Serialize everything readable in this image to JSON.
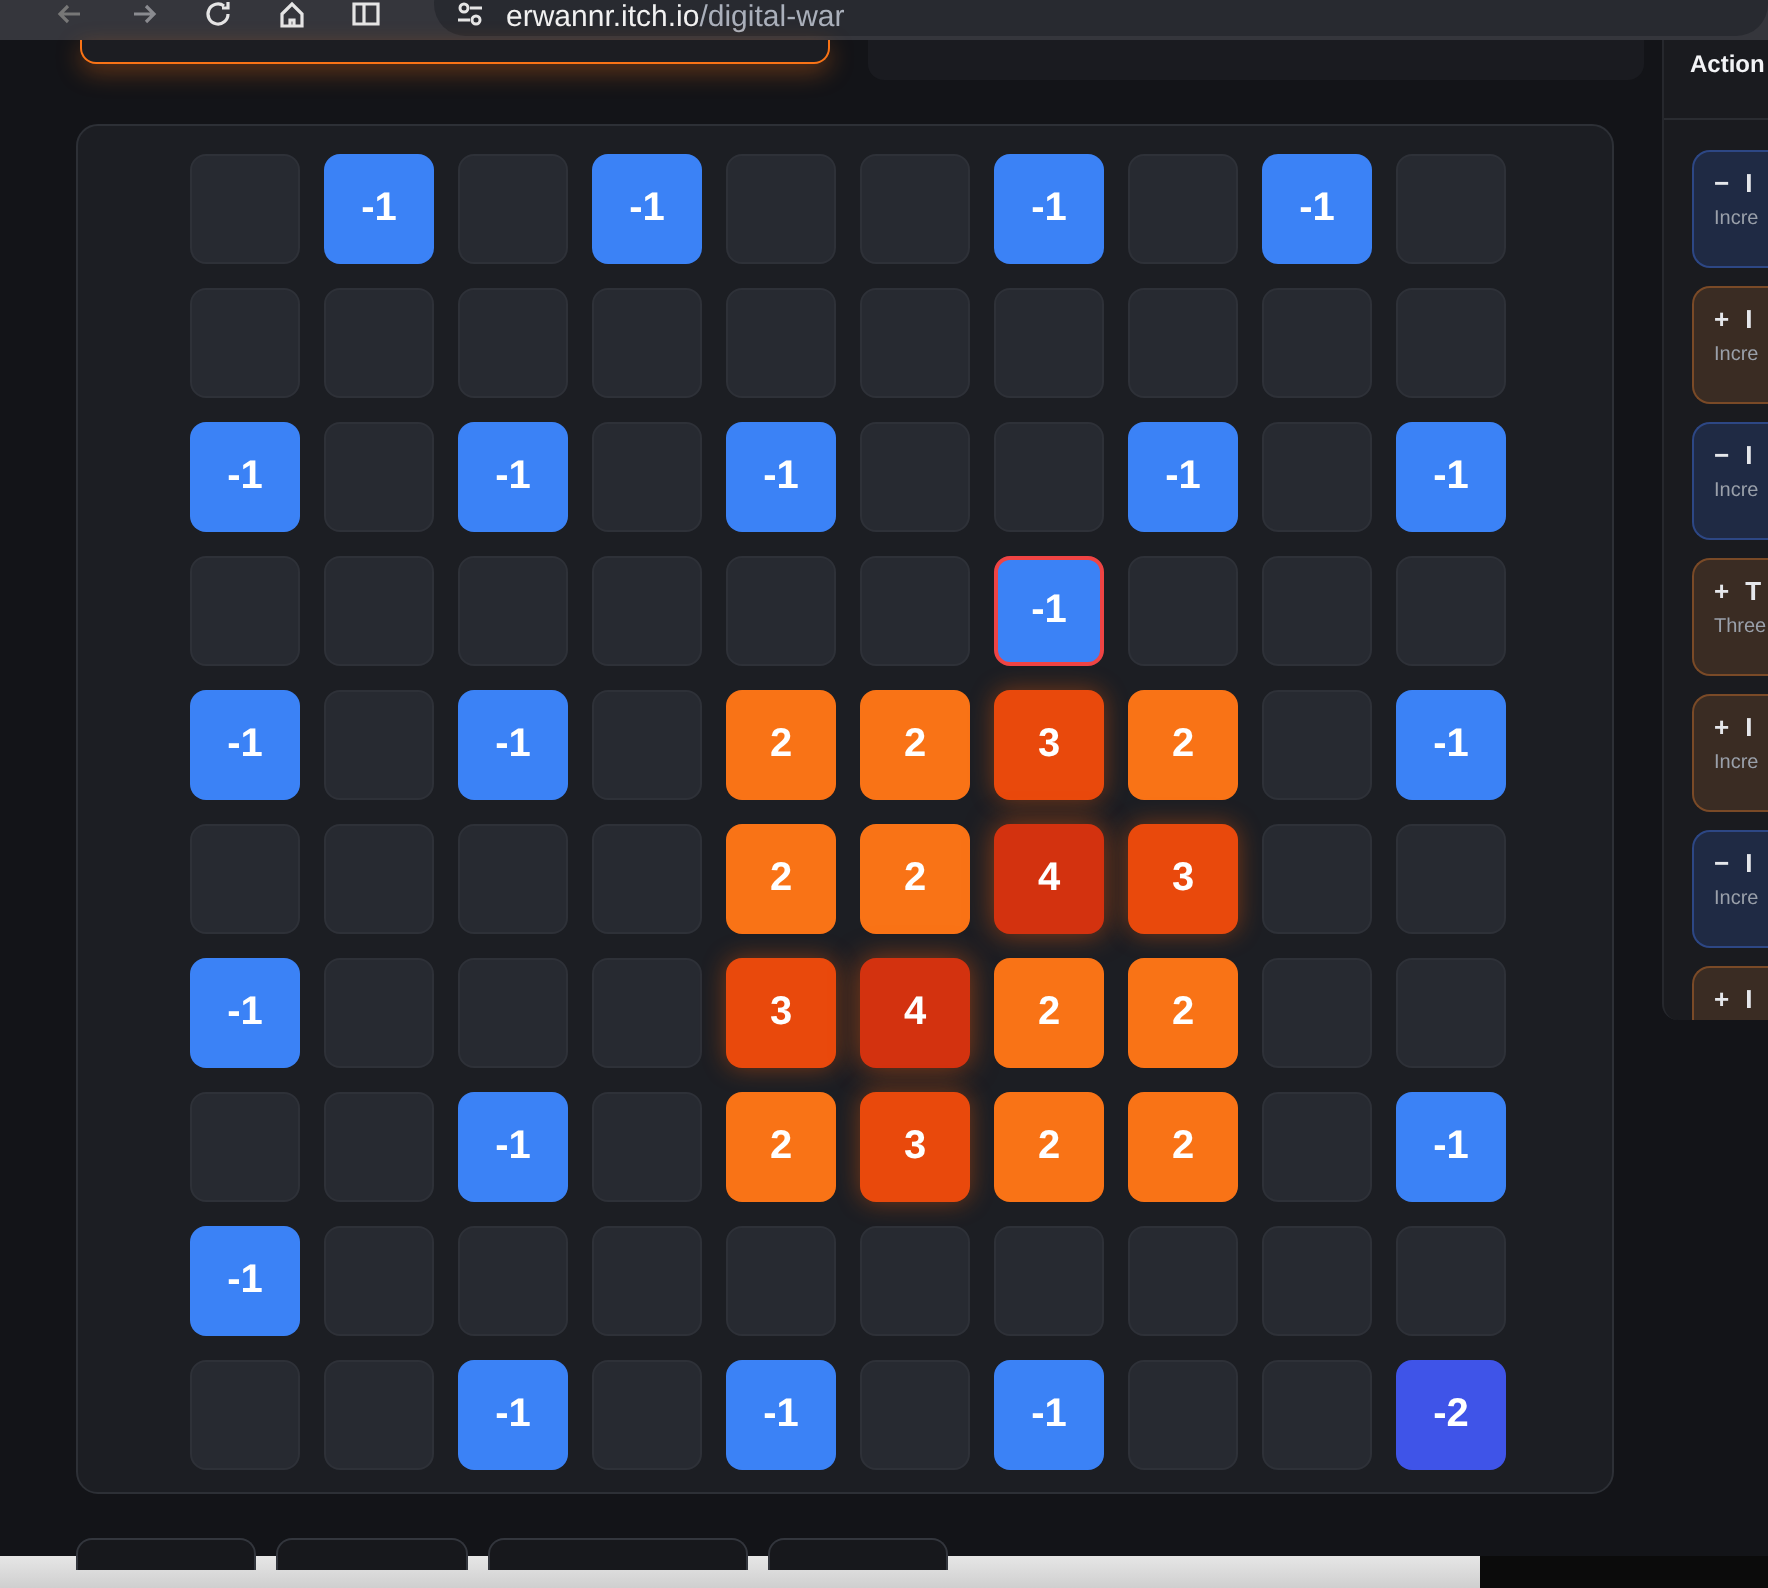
{
  "browser": {
    "url_host": "erwannr.itch.io",
    "url_path": "/digital-war"
  },
  "board": {
    "rows": [
      [
        {
          "kind": "empty",
          "selected": false
        },
        {
          "kind": "minus",
          "value": "-1",
          "selected": false
        },
        {
          "kind": "empty",
          "selected": false
        },
        {
          "kind": "minus",
          "value": "-1",
          "selected": false
        },
        {
          "kind": "empty",
          "selected": false
        },
        {
          "kind": "empty",
          "selected": false
        },
        {
          "kind": "minus",
          "value": "-1",
          "selected": false
        },
        {
          "kind": "empty",
          "selected": false
        },
        {
          "kind": "minus",
          "value": "-1",
          "selected": false
        },
        {
          "kind": "empty",
          "selected": false
        }
      ],
      [
        {
          "kind": "empty",
          "selected": false
        },
        {
          "kind": "empty",
          "selected": false
        },
        {
          "kind": "empty",
          "selected": false
        },
        {
          "kind": "empty",
          "selected": false
        },
        {
          "kind": "empty",
          "selected": false
        },
        {
          "kind": "empty",
          "selected": false
        },
        {
          "kind": "empty",
          "selected": false
        },
        {
          "kind": "empty",
          "selected": false
        },
        {
          "kind": "empty",
          "selected": false
        },
        {
          "kind": "empty",
          "selected": false
        }
      ],
      [
        {
          "kind": "minus",
          "value": "-1",
          "selected": false
        },
        {
          "kind": "empty",
          "selected": false
        },
        {
          "kind": "minus",
          "value": "-1",
          "selected": false
        },
        {
          "kind": "empty",
          "selected": false
        },
        {
          "kind": "minus",
          "value": "-1",
          "selected": false
        },
        {
          "kind": "empty",
          "selected": false
        },
        {
          "kind": "empty",
          "selected": false
        },
        {
          "kind": "minus",
          "value": "-1",
          "selected": false
        },
        {
          "kind": "empty",
          "selected": false
        },
        {
          "kind": "minus",
          "value": "-1",
          "selected": false
        }
      ],
      [
        {
          "kind": "empty",
          "selected": false
        },
        {
          "kind": "empty",
          "selected": false
        },
        {
          "kind": "empty",
          "selected": false
        },
        {
          "kind": "empty",
          "selected": false
        },
        {
          "kind": "empty",
          "selected": false
        },
        {
          "kind": "empty",
          "selected": false
        },
        {
          "kind": "minus",
          "value": "-1",
          "selected": true
        },
        {
          "kind": "empty",
          "selected": false
        },
        {
          "kind": "empty",
          "selected": false
        },
        {
          "kind": "empty",
          "selected": false
        }
      ],
      [
        {
          "kind": "minus",
          "value": "-1",
          "selected": false
        },
        {
          "kind": "empty",
          "selected": false
        },
        {
          "kind": "minus",
          "value": "-1",
          "selected": false
        },
        {
          "kind": "empty",
          "selected": false
        },
        {
          "kind": "plus",
          "value": "2",
          "selected": false
        },
        {
          "kind": "plus",
          "value": "2",
          "selected": false
        },
        {
          "kind": "plus3",
          "value": "3",
          "selected": false
        },
        {
          "kind": "plus",
          "value": "2",
          "selected": false
        },
        {
          "kind": "empty",
          "selected": false
        },
        {
          "kind": "minus",
          "value": "-1",
          "selected": false
        }
      ],
      [
        {
          "kind": "empty",
          "selected": false
        },
        {
          "kind": "empty",
          "selected": false
        },
        {
          "kind": "empty",
          "selected": false
        },
        {
          "kind": "empty",
          "selected": false
        },
        {
          "kind": "plus",
          "value": "2",
          "selected": false
        },
        {
          "kind": "plus",
          "value": "2",
          "selected": false
        },
        {
          "kind": "plus4",
          "value": "4",
          "selected": false
        },
        {
          "kind": "plus3",
          "value": "3",
          "selected": false
        },
        {
          "kind": "empty",
          "selected": false
        },
        {
          "kind": "empty",
          "selected": false
        }
      ],
      [
        {
          "kind": "minus",
          "value": "-1",
          "selected": false
        },
        {
          "kind": "empty",
          "selected": false
        },
        {
          "kind": "empty",
          "selected": false
        },
        {
          "kind": "empty",
          "selected": false
        },
        {
          "kind": "plus3",
          "value": "3",
          "selected": false
        },
        {
          "kind": "plus4",
          "value": "4",
          "selected": false
        },
        {
          "kind": "plus",
          "value": "2",
          "selected": false
        },
        {
          "kind": "plus",
          "value": "2",
          "selected": false
        },
        {
          "kind": "empty",
          "selected": false
        },
        {
          "kind": "empty",
          "selected": false
        }
      ],
      [
        {
          "kind": "empty",
          "selected": false
        },
        {
          "kind": "empty",
          "selected": false
        },
        {
          "kind": "minus",
          "value": "-1",
          "selected": false
        },
        {
          "kind": "empty",
          "selected": false
        },
        {
          "kind": "plus",
          "value": "2",
          "selected": false
        },
        {
          "kind": "plus3",
          "value": "3",
          "selected": false
        },
        {
          "kind": "plus",
          "value": "2",
          "selected": false
        },
        {
          "kind": "plus",
          "value": "2",
          "selected": false
        },
        {
          "kind": "empty",
          "selected": false
        },
        {
          "kind": "minus",
          "value": "-1",
          "selected": false
        }
      ],
      [
        {
          "kind": "minus",
          "value": "-1",
          "selected": false
        },
        {
          "kind": "empty",
          "selected": false
        },
        {
          "kind": "empty",
          "selected": false
        },
        {
          "kind": "empty",
          "selected": false
        },
        {
          "kind": "empty",
          "selected": false
        },
        {
          "kind": "empty",
          "selected": false
        },
        {
          "kind": "empty",
          "selected": false
        },
        {
          "kind": "empty",
          "selected": false
        },
        {
          "kind": "empty",
          "selected": false
        },
        {
          "kind": "empty",
          "selected": false
        }
      ],
      [
        {
          "kind": "empty",
          "selected": false
        },
        {
          "kind": "empty",
          "selected": false
        },
        {
          "kind": "minus",
          "value": "-1",
          "selected": false
        },
        {
          "kind": "empty",
          "selected": false
        },
        {
          "kind": "minus",
          "value": "-1",
          "selected": false
        },
        {
          "kind": "empty",
          "selected": false
        },
        {
          "kind": "minus",
          "value": "-1",
          "selected": false
        },
        {
          "kind": "empty",
          "selected": false
        },
        {
          "kind": "empty",
          "selected": false
        },
        {
          "kind": "minus2",
          "value": "-2",
          "selected": false
        }
      ]
    ]
  },
  "actions": {
    "title": "Action",
    "cards": [
      {
        "kind": "minus",
        "sign": "−",
        "title": "I",
        "text": "Incre"
      },
      {
        "kind": "plus",
        "sign": "+",
        "title": "I",
        "text": "Incre"
      },
      {
        "kind": "minus",
        "sign": "−",
        "title": "I",
        "text": "Incre"
      },
      {
        "kind": "plus",
        "sign": "+",
        "title": "T",
        "text": "Three"
      },
      {
        "kind": "plus",
        "sign": "+",
        "title": "I",
        "text": "Incre"
      },
      {
        "kind": "minus",
        "sign": "−",
        "title": "I",
        "text": "Incre"
      },
      {
        "kind": "plus",
        "sign": "+",
        "title": "I"
      }
    ]
  },
  "toolbar": {
    "buttons": [
      {
        "kind": "undo"
      },
      {
        "kind": "flag"
      },
      {
        "kind": "switch"
      },
      {
        "kind": "info"
      }
    ]
  }
}
